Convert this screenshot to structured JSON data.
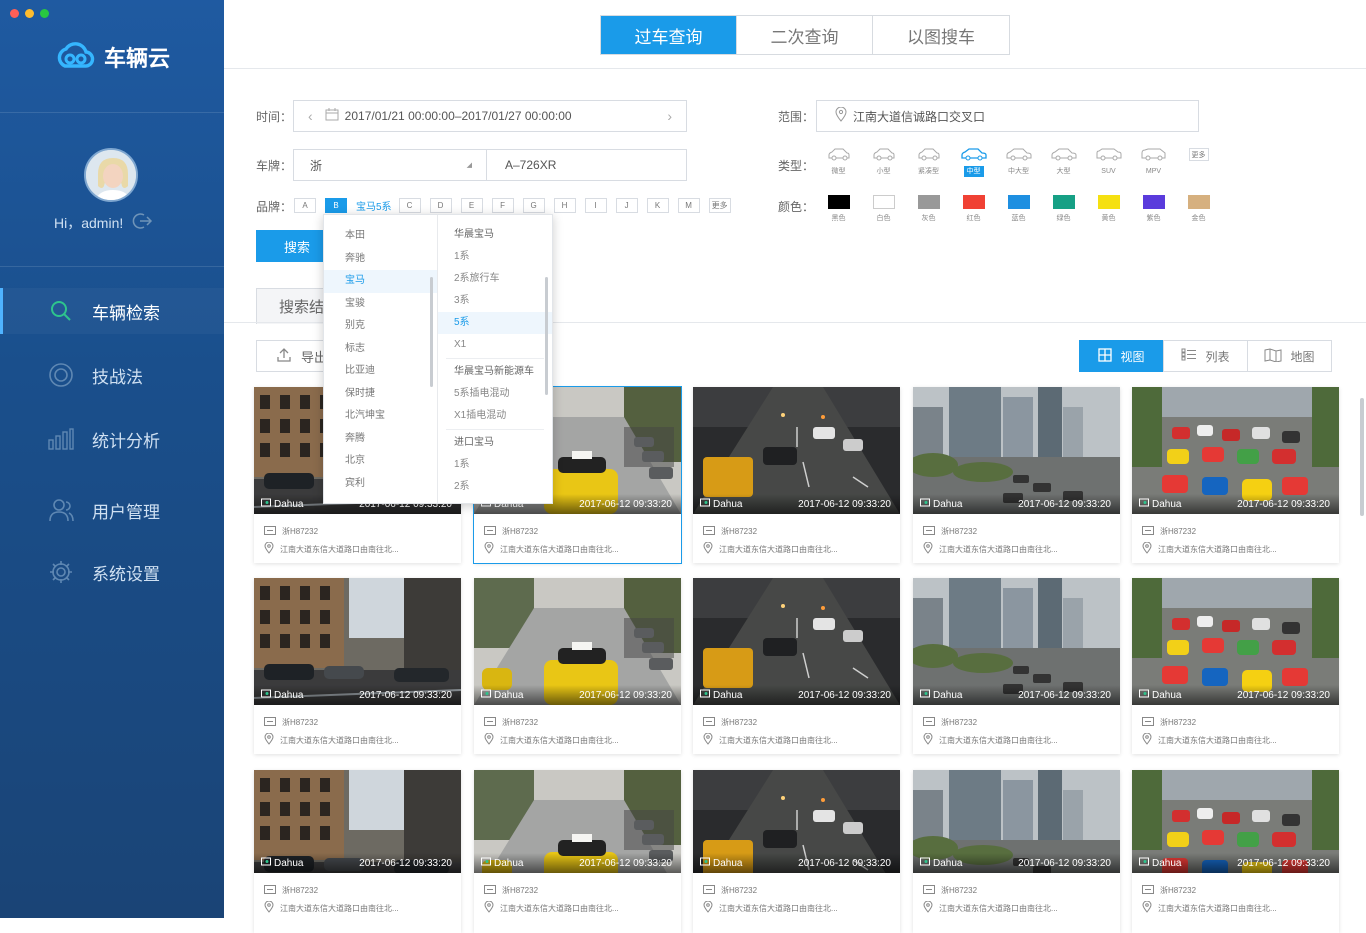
{
  "app": {
    "title": "车辆云"
  },
  "user": {
    "greeting": "Hi，admin!"
  },
  "nav": [
    {
      "label": "车辆检索",
      "icon": "search-icon",
      "active": true
    },
    {
      "label": "技战法",
      "icon": "target-icon",
      "active": false
    },
    {
      "label": "统计分析",
      "icon": "bar-chart-icon",
      "active": false
    },
    {
      "label": "用户管理",
      "icon": "users-icon",
      "active": false
    },
    {
      "label": "系统设置",
      "icon": "gear-icon",
      "active": false
    }
  ],
  "tabs": [
    "过车查询",
    "二次查询",
    "以图搜车"
  ],
  "filters": {
    "time_label": "时间：",
    "time_value": "2017/01/21 00:00:00–2017/01/27 00:00:00",
    "plate_label": "车牌：",
    "plate_province": "浙",
    "plate_number": "A–726XR",
    "brand_label": "品牌：",
    "brand_letters": [
      "A",
      "B",
      "C",
      "D",
      "E",
      "F",
      "G",
      "H",
      "I",
      "J",
      "K",
      "M",
      "更多"
    ],
    "brand_selected": "B",
    "brand_tag": "宝马5系",
    "range_label": "范围：",
    "range_value": "江南大道信诚路口交叉口",
    "type_label": "类型：",
    "types": [
      "微型",
      "小型",
      "紧凑型",
      "中型",
      "中大型",
      "大型",
      "SUV",
      "MPV"
    ],
    "type_more": "更多",
    "type_selected": "中型",
    "color_label": "颜色：",
    "colors": [
      {
        "name": "黑色",
        "hex": "#000000"
      },
      {
        "name": "白色",
        "hex": "#ffffff"
      },
      {
        "name": "灰色",
        "hex": "#999999"
      },
      {
        "name": "红色",
        "hex": "#f04134"
      },
      {
        "name": "蓝色",
        "hex": "#1e8fe1"
      },
      {
        "name": "绿色",
        "hex": "#16a085"
      },
      {
        "name": "黄色",
        "hex": "#f5e011"
      },
      {
        "name": "紫色",
        "hex": "#5a3bdc"
      },
      {
        "name": "金色",
        "hex": "#d6b07f"
      }
    ],
    "search_button": "搜索"
  },
  "dropdown": {
    "brands": [
      "本田",
      "奔驰",
      "宝马",
      "宝骏",
      "别克",
      "标志",
      "比亚迪",
      "保时捷",
      "北汽坤宝",
      "奔腾",
      "北京",
      "宾利"
    ],
    "brand_selected": "宝马",
    "groups": [
      {
        "name": "华晨宝马",
        "items": [
          "1系",
          "2系旅行车",
          "3系",
          "5系",
          "X1"
        ]
      },
      {
        "name": "华晨宝马新能源车",
        "items": [
          "5系插电混动",
          "X1插电混动"
        ]
      },
      {
        "name": "进口宝马",
        "items": [
          "1系",
          "2系"
        ]
      }
    ],
    "model_selected": "5系"
  },
  "results": {
    "tab_label": "搜索结",
    "export_label": "导出",
    "view_modes": [
      {
        "label": "视图",
        "icon": "grid-icon",
        "active": true
      },
      {
        "label": "列表",
        "icon": "list-icon",
        "active": false
      },
      {
        "label": "地图",
        "icon": "map-icon",
        "active": false
      }
    ],
    "card_brand": "Dahua",
    "card_time": "2017-06-12 09:33:20",
    "card_plate": "浙H87232",
    "card_location": "江南大道东信大道路口由南往北...",
    "scenes": [
      "street",
      "taxi",
      "night",
      "city",
      "traffic"
    ]
  },
  "accent": "#1a9be9"
}
